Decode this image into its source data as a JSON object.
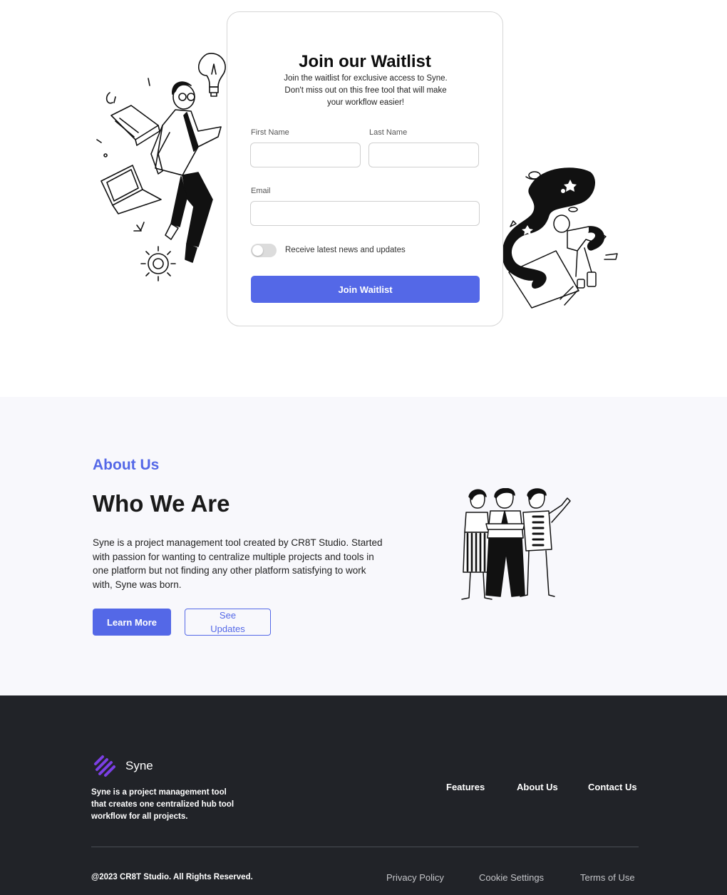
{
  "waitlist": {
    "title": "Join our Waitlist",
    "subtitle": "Join the waitlist for exclusive access to Syne. Don't miss out on this free tool that will make your workflow easier!",
    "first_name_label": "First Name",
    "first_name_value": "",
    "last_name_label": "Last Name",
    "last_name_value": "",
    "email_label": "Email",
    "email_value": "",
    "toggle_label": "Receive latest news and updates",
    "toggle_on": false,
    "submit_label": "Join Waitlist"
  },
  "about": {
    "eyebrow": "About Us",
    "title": "Who We Are",
    "body": "Syne is a project management tool created by CR8T Studio. Started with passion for wanting to centralize multiple projects and tools in one platform but not finding any other platform satisfying to work with, Syne was born.",
    "primary_button": "Learn More",
    "secondary_button": "See Updates"
  },
  "footer": {
    "brand": "Syne",
    "description": "Syne is a project management tool that creates one centralized hub tool workflow for all projects.",
    "nav": [
      "Features",
      "About Us",
      "Contact Us"
    ],
    "copyright": "@2023 CR8T Studio. All Rights Reserved.",
    "legal": [
      "Privacy Policy",
      "Cookie Settings",
      "Terms of Use"
    ]
  },
  "colors": {
    "accent": "#5468e7",
    "footer_bg": "#212328",
    "about_bg": "#f8f8fc",
    "logo": "#7b3fe4"
  }
}
